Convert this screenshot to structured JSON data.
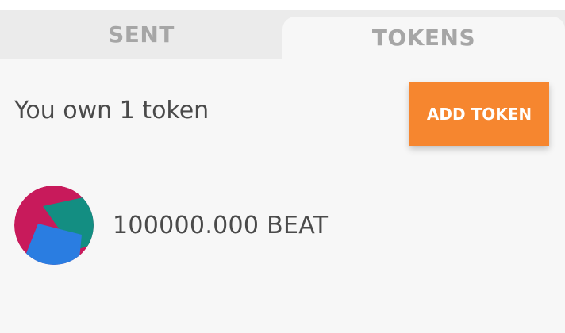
{
  "tabs": [
    {
      "label": "SENT",
      "active": false
    },
    {
      "label": "TOKENS",
      "active": true
    }
  ],
  "tokens_view": {
    "summary": "You own 1 token",
    "add_button_label": "ADD TOKEN",
    "token_list": [
      {
        "amount": "100000.000",
        "symbol": "BEAT",
        "display": "100000.000 BEAT",
        "identicon": "jazzicon-identicon"
      }
    ]
  },
  "colors": {
    "accent": "#f6862f",
    "tab_inactive_bg": "#ebebeb",
    "panel_bg": "#f7f7f7",
    "tab_text": "#a6a6a6",
    "body_text": "#4a4a4a",
    "identicon_red": "#c81a5b",
    "identicon_teal": "#138e82",
    "identicon_blue": "#2a7de1"
  }
}
